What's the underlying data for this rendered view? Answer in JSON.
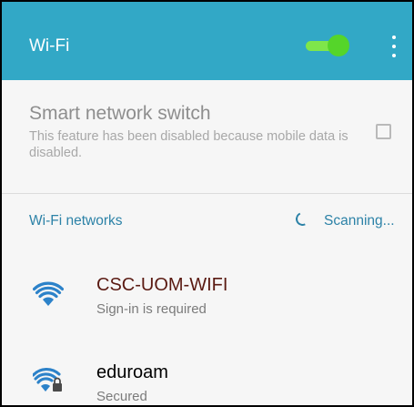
{
  "app_bar": {
    "title": "Wi-Fi",
    "wifi_switch_on": true,
    "accent_color": "#32a8c6",
    "switch_color": "#55d52a"
  },
  "smart_switch": {
    "title": "Smart network switch",
    "description": "This feature has been disabled because mobile data is disabled.",
    "checked": false
  },
  "networks_section": {
    "header": "Wi-Fi networks",
    "status": "Scanning..."
  },
  "networks": [
    {
      "name": "CSC-UOM-WIFI",
      "status": "Sign-in is required",
      "secured": false,
      "name_color": "#5a1a12"
    },
    {
      "name": "eduroam",
      "status": "Secured",
      "secured": true,
      "name_color": "#000000"
    }
  ]
}
